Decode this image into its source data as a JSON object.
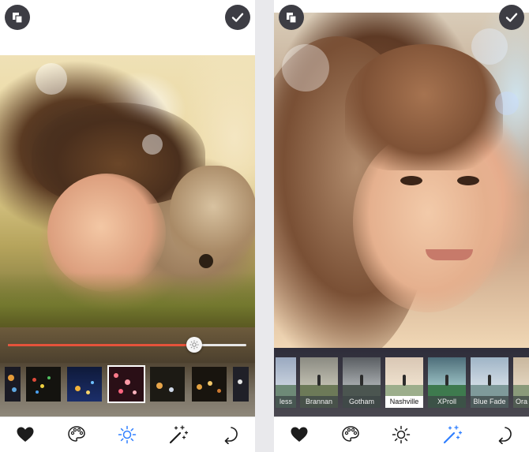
{
  "colors": {
    "accent_blue": "#2f7fff",
    "slider_fill": "#e5533b",
    "top_button_bg": "#3d3d44",
    "icon_dark": "#1c1c1c"
  },
  "left_screen": {
    "top_bar": {
      "left_icon": "copy-icon",
      "right_icon": "checkmark-icon"
    },
    "slider": {
      "value": 0.78
    },
    "thumbnails": [
      {
        "name": "bokeh-1",
        "selected": false
      },
      {
        "name": "bokeh-2",
        "selected": false
      },
      {
        "name": "bokeh-3",
        "selected": false
      },
      {
        "name": "bokeh-4",
        "selected": true
      },
      {
        "name": "bokeh-5",
        "selected": false
      },
      {
        "name": "bokeh-6",
        "selected": false
      },
      {
        "name": "bokeh-7",
        "selected": false
      }
    ],
    "toolbar": {
      "active": "brightness",
      "items": [
        "heart-icon",
        "palette-icon",
        "brightness-icon",
        "magic-wand-icon",
        "undo-icon"
      ]
    }
  },
  "right_screen": {
    "top_bar": {
      "left_icon": "copy-icon",
      "right_icon": "checkmark-icon"
    },
    "filters": [
      {
        "label": "less",
        "selected": false
      },
      {
        "label": "Brannan",
        "selected": false
      },
      {
        "label": "Gotham",
        "selected": false
      },
      {
        "label": "Nashville",
        "selected": true
      },
      {
        "label": "XProll",
        "selected": false
      },
      {
        "label": "Blue Fade",
        "selected": false
      },
      {
        "label": "Ora",
        "selected": false
      }
    ],
    "toolbar": {
      "active": "magic-wand",
      "items": [
        "heart-icon",
        "palette-icon",
        "brightness-icon",
        "magic-wand-icon",
        "undo-icon"
      ]
    }
  }
}
